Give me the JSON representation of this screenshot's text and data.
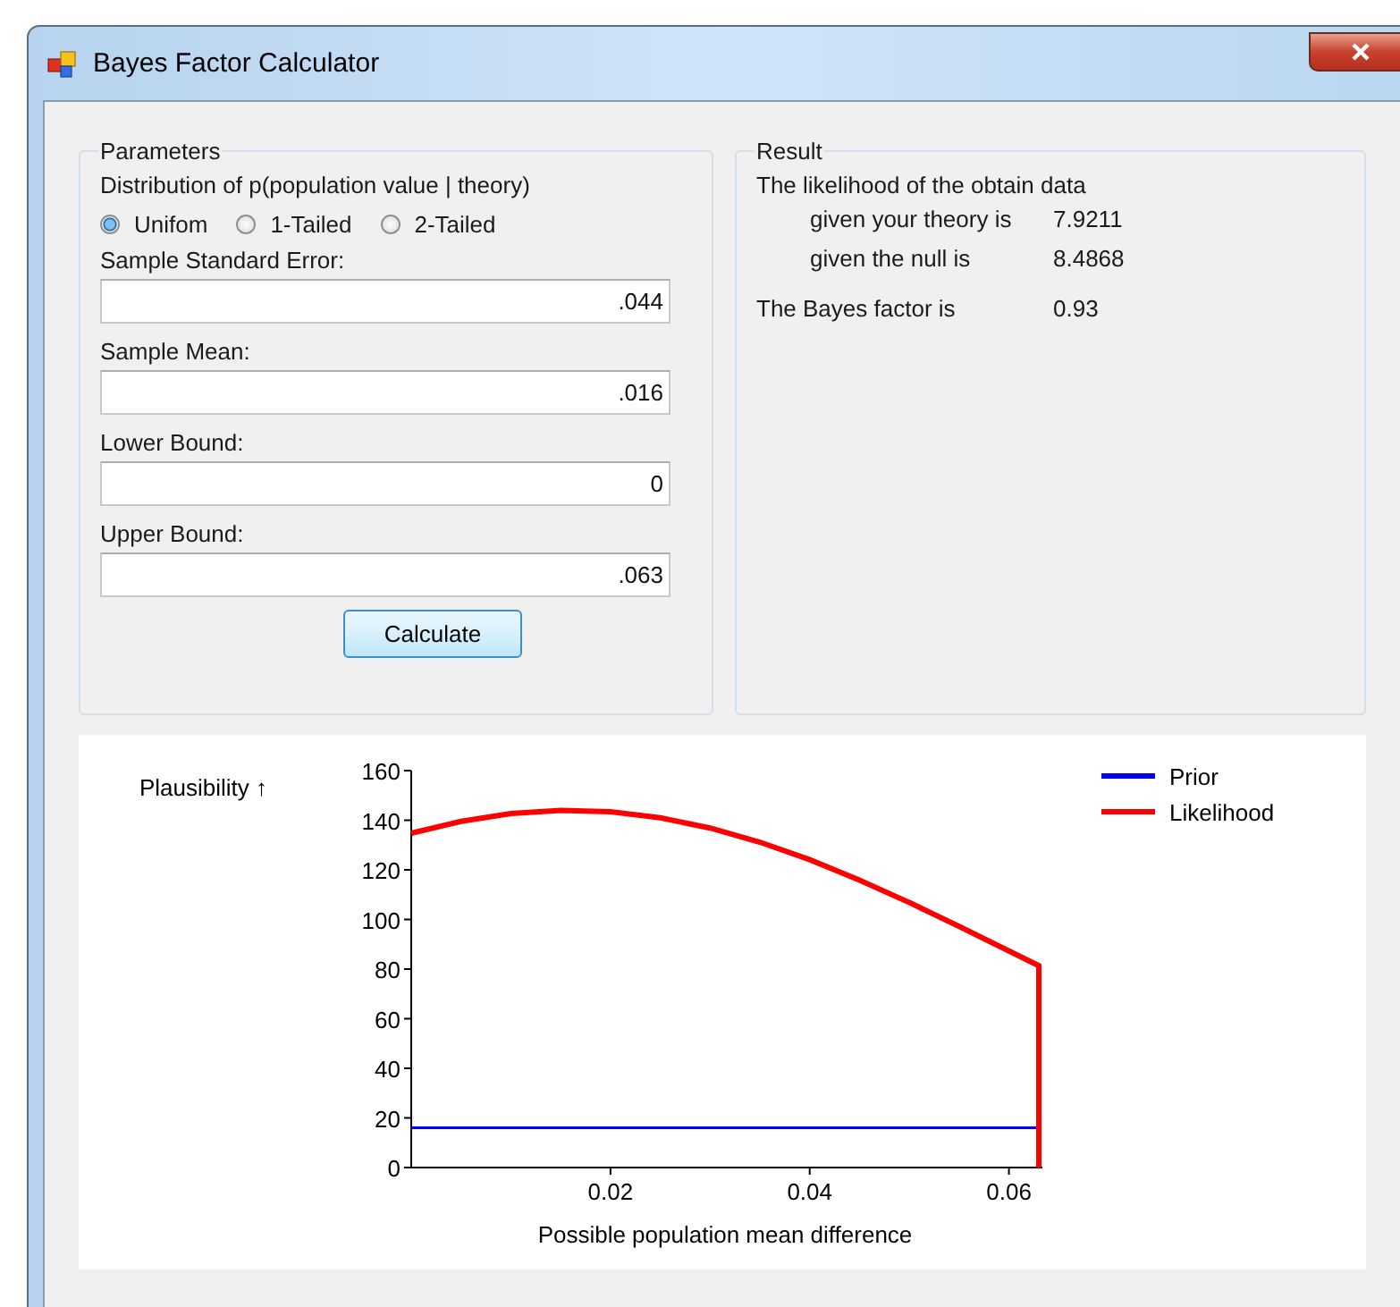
{
  "window": {
    "title": "Bayes Factor Calculator"
  },
  "parameters": {
    "title": "Parameters",
    "distribution_label": "Distribution of p(population value | theory)",
    "distribution_options": [
      {
        "label": "Unifom",
        "selected": true
      },
      {
        "label": "1-Tailed",
        "selected": false
      },
      {
        "label": "2-Tailed",
        "selected": false
      }
    ],
    "fields": [
      {
        "label": "Sample Standard Error:",
        "value": ".044"
      },
      {
        "label": "Sample Mean:",
        "value": ".016"
      },
      {
        "label": "Lower Bound:",
        "value": "0"
      },
      {
        "label": "Upper Bound:",
        "value": ".063"
      }
    ],
    "calculate_button": "Calculate"
  },
  "result": {
    "title": "Result",
    "intro": "The likelihood of the obtain data",
    "rows": [
      {
        "label": "given your theory is",
        "value": "7.9211",
        "kind": "sub"
      },
      {
        "label": "given the null is",
        "value": "8.4868",
        "kind": "sub"
      },
      {
        "label": "The Bayes factor is",
        "value": "0.93",
        "kind": "main"
      }
    ]
  },
  "plot": {
    "chart_data": {
      "type": "line",
      "xlabel": "Possible population mean difference",
      "ylabel": "Plausibility ↑",
      "x": [
        0,
        0.005,
        0.01,
        0.015,
        0.02,
        0.025,
        0.03,
        0.035,
        0.04,
        0.045,
        0.05,
        0.055,
        0.06,
        0.063,
        0.063
      ],
      "series": [
        {
          "name": "Prior",
          "color": "#0000ff",
          "values": [
            16,
            16,
            16,
            16,
            16,
            16,
            16,
            16,
            16,
            16,
            16,
            16,
            16,
            16,
            16
          ]
        },
        {
          "name": "Likelihood",
          "color": "#ff0000",
          "values": [
            134.8,
            139.5,
            142.7,
            144,
            143.4,
            141,
            136.9,
            131.2,
            124.1,
            115.9,
            106.8,
            97.2,
            87.3,
            81.4,
            0
          ]
        }
      ],
      "legend": true,
      "xlim": [
        0,
        0.063
      ],
      "ylim": [
        0,
        160
      ],
      "xticks": [
        {
          "value": 0.02,
          "label": "0.02"
        },
        {
          "value": 0.04,
          "label": "0.04"
        },
        {
          "value": 0.06,
          "label": "0.06"
        }
      ],
      "yticks": [
        {
          "value": 0,
          "label": "0"
        },
        {
          "value": 20,
          "label": "20"
        },
        {
          "value": 40,
          "label": "40"
        },
        {
          "value": 60,
          "label": "60"
        },
        {
          "value": 80,
          "label": "80"
        },
        {
          "value": 100,
          "label": "100"
        },
        {
          "value": 120,
          "label": "120"
        },
        {
          "value": 140,
          "label": "140"
        },
        {
          "value": 160,
          "label": "160"
        }
      ]
    }
  }
}
